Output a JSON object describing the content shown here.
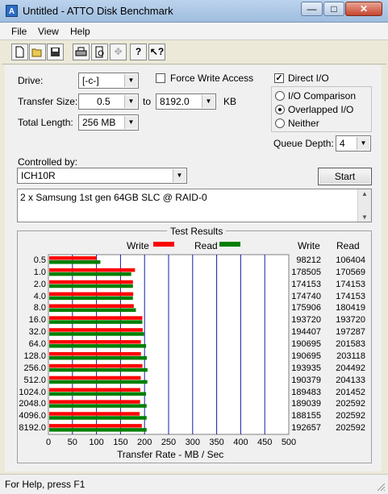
{
  "window": {
    "title": "Untitled - ATTO Disk Benchmark",
    "icon_letter": "A"
  },
  "menu": [
    {
      "label": "File",
      "key": "F"
    },
    {
      "label": "View",
      "key": "V"
    },
    {
      "label": "Help",
      "key": "H"
    }
  ],
  "toolbar": {
    "buttons": [
      "new-icon",
      "open-icon",
      "save-icon",
      "print-icon",
      "print-preview-icon",
      "move-icon",
      "help-icon",
      "context-help-icon"
    ]
  },
  "form": {
    "drive_label": "Drive:",
    "drive_value": "[-c-]",
    "force_write_label": "Force Write Access",
    "force_write_checked": false,
    "direct_io_label": "Direct I/O",
    "direct_io_checked": true,
    "transfer_size_label": "Transfer Size:",
    "transfer_from": "0.5",
    "transfer_to_label": "to",
    "transfer_to": "8192.0",
    "transfer_unit": "KB",
    "total_length_label": "Total Length:",
    "total_length_value": "256 MB",
    "io_options": [
      {
        "label": "I/O Comparison",
        "checked": false
      },
      {
        "label": "Overlapped I/O",
        "checked": true
      },
      {
        "label": "Neither",
        "checked": false
      }
    ],
    "queue_depth_label": "Queue Depth:",
    "queue_depth_value": "4",
    "controlled_by_label": "Controlled by:",
    "controlled_by_value": "ICH10R",
    "start_label": "Start",
    "description": "2 x Samsung 1st gen 64GB SLC @ RAID-0"
  },
  "results": {
    "title": "Test Results",
    "legend_write": "Write",
    "legend_read": "Read",
    "col_write": "Write",
    "col_read": "Read",
    "x_label": "Transfer Rate - MB / Sec",
    "x_ticks": [
      "0",
      "50",
      "100",
      "150",
      "200",
      "250",
      "300",
      "350",
      "400",
      "450",
      "500"
    ],
    "write_color": "#ff0000",
    "read_color": "#008000"
  },
  "chart_data": {
    "type": "bar",
    "title": "Test Results",
    "xlabel": "Transfer Rate - MB / Sec",
    "xlim": [
      0,
      500
    ],
    "categories": [
      "0.5",
      "1.0",
      "2.0",
      "4.0",
      "8.0",
      "16.0",
      "32.0",
      "64.0",
      "128.0",
      "256.0",
      "512.0",
      "1024.0",
      "2048.0",
      "4096.0",
      "8192.0"
    ],
    "series": [
      {
        "name": "Write",
        "values": [
          98212,
          178505,
          174153,
          174740,
          175906,
          193720,
          194407,
          190695,
          190695,
          193935,
          190379,
          189483,
          189039,
          188155,
          192657
        ]
      },
      {
        "name": "Read",
        "values": [
          106404,
          170569,
          174153,
          174153,
          180419,
          193720,
          197287,
          201583,
          203118,
          204492,
          204133,
          201452,
          202592,
          202592,
          202592
        ]
      }
    ]
  },
  "status": {
    "text": "For Help, press F1"
  }
}
